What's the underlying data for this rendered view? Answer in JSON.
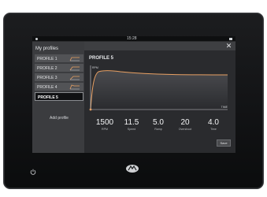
{
  "status": {
    "clock": "15:28"
  },
  "sidebar": {
    "title": "My profiles",
    "items": [
      {
        "label": "PROFILE 1"
      },
      {
        "label": "PROFILE 2"
      },
      {
        "label": "PROFILE 3"
      },
      {
        "label": "PROFILE 4"
      },
      {
        "label": "PROFILE 5"
      }
    ],
    "add_label": "Add profile"
  },
  "main": {
    "title": "PROFILE 5",
    "y_axis_label": "RPM",
    "x_axis_label": "TIME",
    "metrics": [
      {
        "value": "1500",
        "label": "RPM"
      },
      {
        "value": "11.5",
        "label": "Speed"
      },
      {
        "value": "5.0",
        "label": "Ramp"
      },
      {
        "value": "20",
        "label": "Overshoot"
      },
      {
        "value": "4.0",
        "label": "Time"
      }
    ],
    "save_label": "Save"
  },
  "colors": {
    "accent": "#e8a063",
    "screen_bg": "#2a2b2e",
    "sidebar_bg": "#3b3c3f"
  },
  "icons": {
    "close": "close-icon",
    "power": "power-icon",
    "logo": "brand-logo"
  }
}
